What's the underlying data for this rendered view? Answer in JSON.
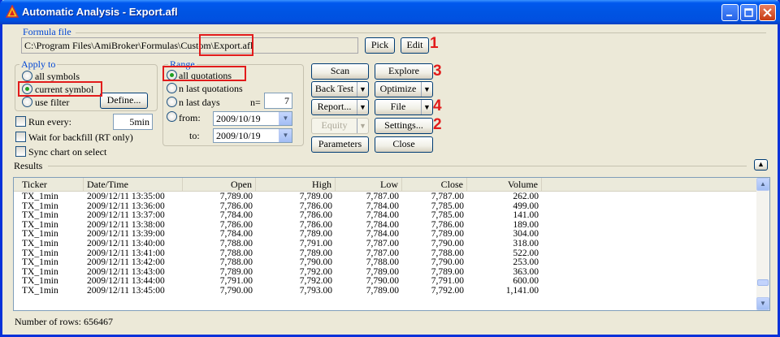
{
  "window": {
    "title": "Automatic Analysis - Export.afl"
  },
  "formula": {
    "group_label": "Formula file",
    "path": "C:\\Program Files\\AmiBroker\\Formulas\\Custom\\Export.afl",
    "pick_label": "Pick",
    "edit_label": "Edit"
  },
  "apply_to": {
    "group_label": "Apply to",
    "options": [
      "all symbols",
      "current symbol",
      "use filter"
    ],
    "selected": "current symbol",
    "define_label": "Define..."
  },
  "range": {
    "group_label": "Range",
    "options": [
      "all quotations",
      "n last quotations",
      "n last days",
      "from:"
    ],
    "selected": "all quotations",
    "n_label": "n=",
    "n_value": "7",
    "from_value": "2009/10/19",
    "to_label": "to:",
    "to_value": "2009/10/19"
  },
  "options": {
    "run_every_label": "Run every:",
    "run_every_value": "5min",
    "wait_label": "Wait for backfill (RT only)",
    "sync_label": "Sync chart on select"
  },
  "buttons": {
    "scan": "Scan",
    "explore": "Explore",
    "backtest": "Back Test",
    "optimize": "Optimize",
    "report": "Report...",
    "file": "File",
    "equity": "Equity",
    "settings": "Settings...",
    "parameters": "Parameters",
    "close": "Close"
  },
  "annotations": [
    "1",
    "2",
    "3",
    "4"
  ],
  "results": {
    "label": "Results",
    "columns": [
      "Ticker",
      "Date/Time",
      "Open",
      "High",
      "Low",
      "Close",
      "Volume"
    ],
    "rows": [
      [
        "TX_1min",
        "2009/12/11 13:35:00",
        "7,789.00",
        "7,789.00",
        "7,787.00",
        "7,787.00",
        "262.00"
      ],
      [
        "TX_1min",
        "2009/12/11 13:36:00",
        "7,786.00",
        "7,786.00",
        "7,784.00",
        "7,785.00",
        "499.00"
      ],
      [
        "TX_1min",
        "2009/12/11 13:37:00",
        "7,784.00",
        "7,786.00",
        "7,784.00",
        "7,785.00",
        "141.00"
      ],
      [
        "TX_1min",
        "2009/12/11 13:38:00",
        "7,786.00",
        "7,786.00",
        "7,784.00",
        "7,786.00",
        "189.00"
      ],
      [
        "TX_1min",
        "2009/12/11 13:39:00",
        "7,784.00",
        "7,789.00",
        "7,784.00",
        "7,789.00",
        "304.00"
      ],
      [
        "TX_1min",
        "2009/12/11 13:40:00",
        "7,788.00",
        "7,791.00",
        "7,787.00",
        "7,790.00",
        "318.00"
      ],
      [
        "TX_1min",
        "2009/12/11 13:41:00",
        "7,788.00",
        "7,789.00",
        "7,787.00",
        "7,788.00",
        "522.00"
      ],
      [
        "TX_1min",
        "2009/12/11 13:42:00",
        "7,788.00",
        "7,790.00",
        "7,788.00",
        "7,790.00",
        "253.00"
      ],
      [
        "TX_1min",
        "2009/12/11 13:43:00",
        "7,789.00",
        "7,792.00",
        "7,789.00",
        "7,789.00",
        "363.00"
      ],
      [
        "TX_1min",
        "2009/12/11 13:44:00",
        "7,791.00",
        "7,792.00",
        "7,790.00",
        "7,791.00",
        "600.00"
      ],
      [
        "TX_1min",
        "2009/12/11 13:45:00",
        "7,790.00",
        "7,793.00",
        "7,789.00",
        "7,792.00",
        "1,141.00"
      ]
    ]
  },
  "status": {
    "rows_text": "Number of rows: 656467"
  }
}
